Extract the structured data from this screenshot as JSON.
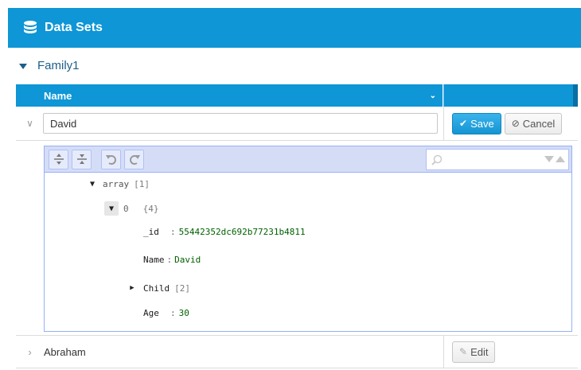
{
  "header": {
    "title": "Data Sets",
    "icon": "database-icon"
  },
  "group": {
    "label": "Family1"
  },
  "grid": {
    "column_name": "Name"
  },
  "edit_row": {
    "name_value": "David",
    "save_label": "Save",
    "cancel_label": "Cancel"
  },
  "json_editor": {
    "search_placeholder": "",
    "tree": {
      "root_name": "array",
      "root_meta": "[1]",
      "item_index": "0",
      "item_meta": "{4}",
      "fields": [
        {
          "key": "_id",
          "sep": ":",
          "value": "55442352dc692b77231b4811"
        },
        {
          "key": "Name",
          "sep": ":",
          "value": "David"
        },
        {
          "key": "Child",
          "meta": "[2]"
        },
        {
          "key": "Age",
          "sep": ":",
          "value": "30"
        }
      ]
    }
  },
  "collapsed_row": {
    "name": "Abraham",
    "edit_label": "Edit"
  },
  "colors": {
    "accent": "#0e96d6",
    "editor_border": "#97b0f8",
    "editor_menu": "#d5ddf6",
    "value_green": "#006000"
  }
}
